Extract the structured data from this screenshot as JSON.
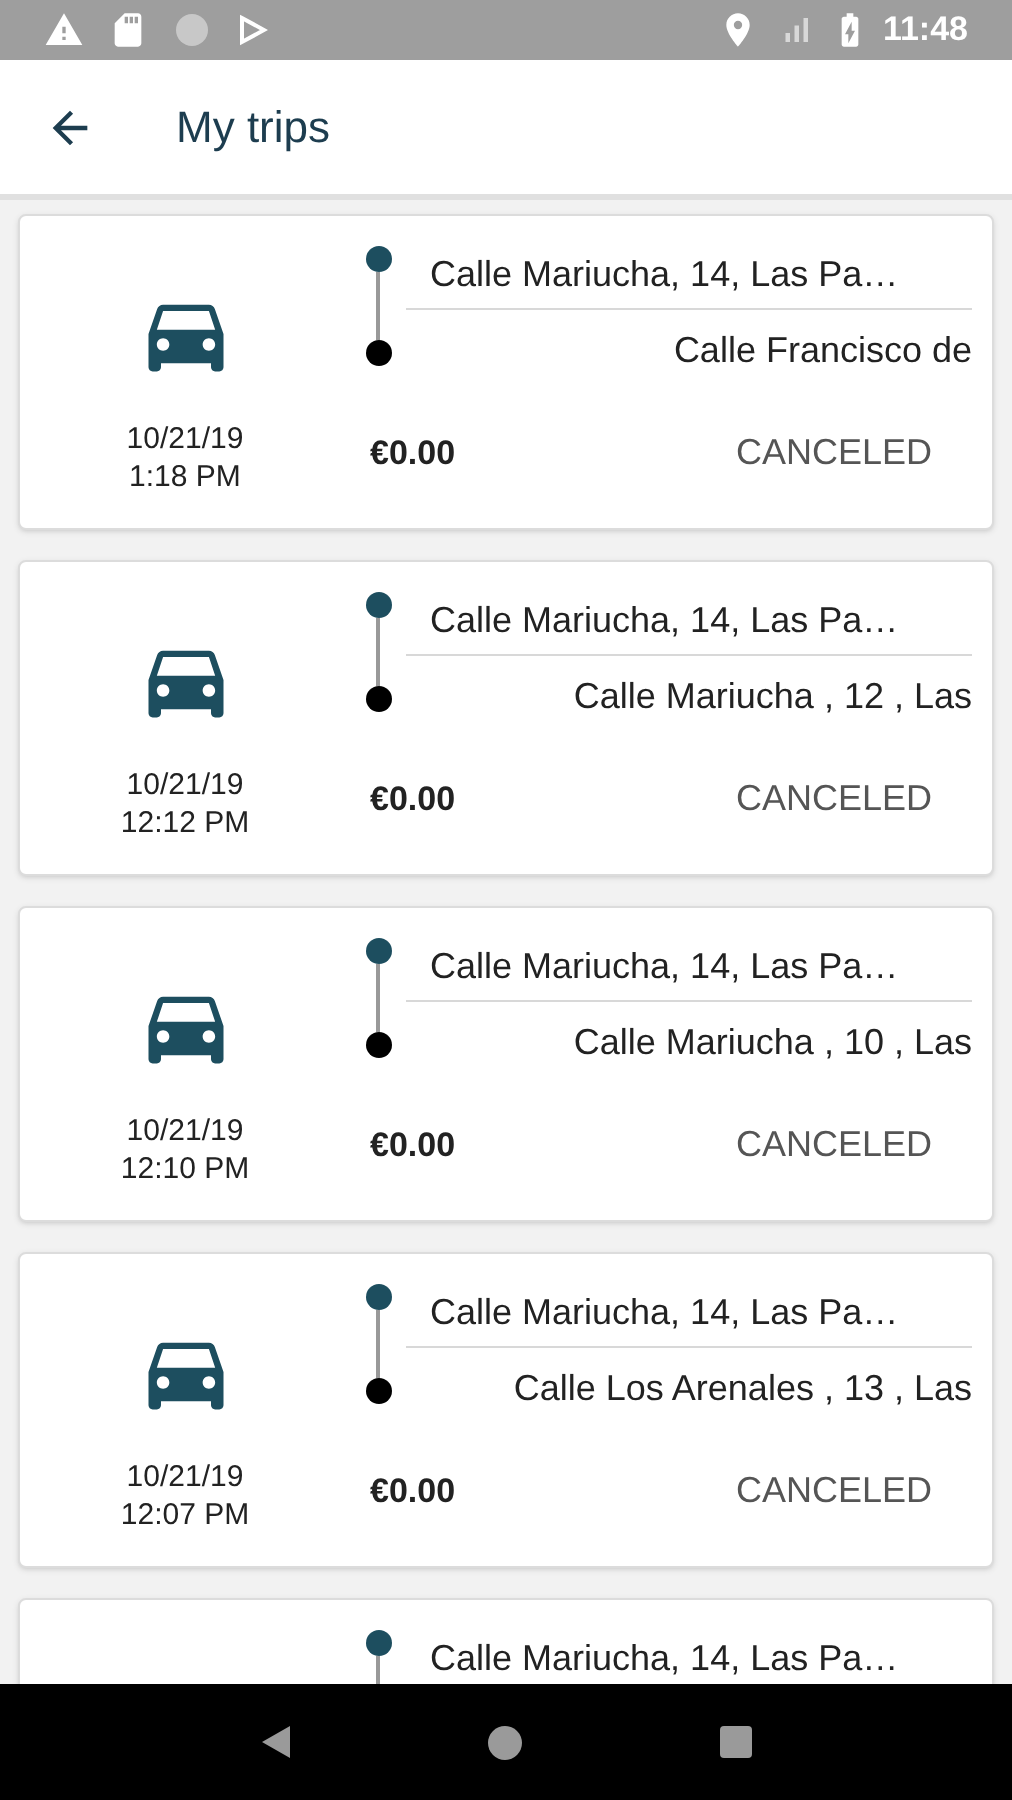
{
  "status_bar": {
    "time": "11:48"
  },
  "app_bar": {
    "title": "My trips"
  },
  "trips": [
    {
      "origin": "Calle Mariucha, 14, Las Pa…",
      "destination": "Calle Francisco de",
      "date": "10/21/19",
      "time": "1:18 PM",
      "price": "€0.00",
      "status": "CANCELED"
    },
    {
      "origin": "Calle Mariucha, 14, Las Pa…",
      "destination": "Calle Mariucha , 12 , Las",
      "date": "10/21/19",
      "time": "12:12 PM",
      "price": "€0.00",
      "status": "CANCELED"
    },
    {
      "origin": "Calle Mariucha, 14, Las Pa…",
      "destination": "Calle Mariucha , 10 , Las",
      "date": "10/21/19",
      "time": "12:10 PM",
      "price": "€0.00",
      "status": "CANCELED"
    },
    {
      "origin": "Calle Mariucha, 14, Las Pa…",
      "destination": "Calle Los Arenales , 13 , Las",
      "date": "10/21/19",
      "time": "12:07 PM",
      "price": "€0.00",
      "status": "CANCELED"
    },
    {
      "origin": "Calle Mariucha, 14, Las Pa…"
    }
  ]
}
